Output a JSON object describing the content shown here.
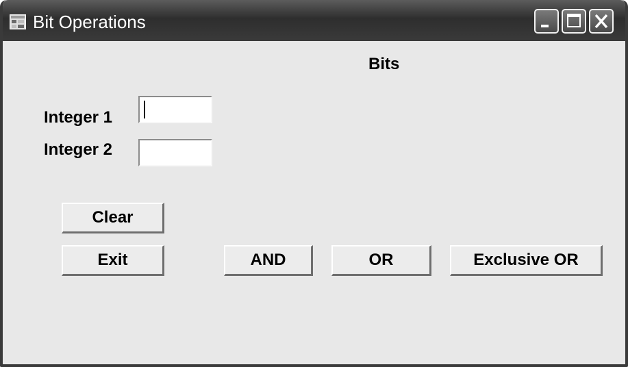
{
  "window": {
    "title": "Bit Operations",
    "app_icon": "form-window-icon",
    "controls": {
      "minimize_icon": "minimize-icon",
      "maximize_icon": "maximize-icon",
      "close_icon": "close-icon"
    }
  },
  "form": {
    "bits_label": "Bits",
    "integer1_label": "Integer 1",
    "integer1_value": "",
    "integer2_label": "Integer 2",
    "integer2_value": "",
    "buttons": {
      "clear": "Clear",
      "exit": "Exit",
      "and": "AND",
      "or": "OR",
      "xor": "Exclusive OR"
    }
  },
  "colors": {
    "titlebar": "#3a3a3a",
    "form_background": "#e8e8e8",
    "button_face": "#ececec"
  }
}
